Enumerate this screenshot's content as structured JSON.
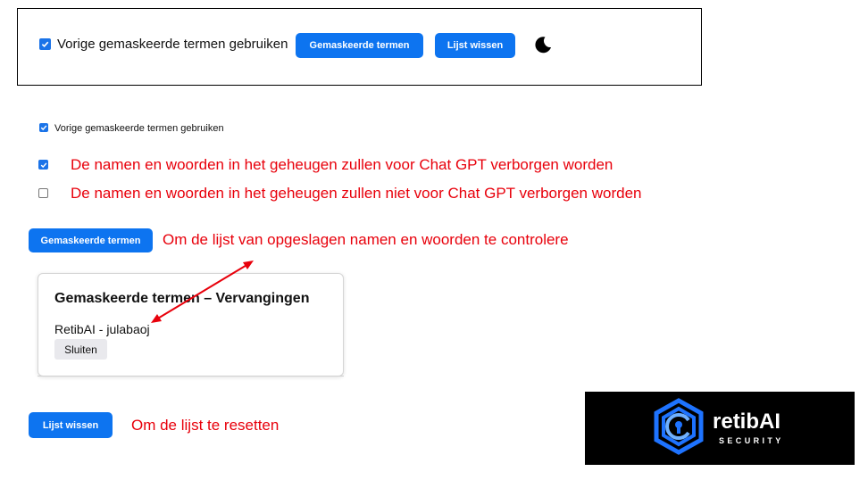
{
  "toolbar": {
    "checkbox_label": "Vorige gemaskeerde termen gebruiken",
    "checkbox_checked": true,
    "masked_terms_button": "Gemaskeerde termen",
    "clear_list_button": "Lijst wissen"
  },
  "small_checkbox": {
    "label": "Vorige gemaskeerde termen gebruiken",
    "checked": true
  },
  "legend": {
    "checked_text": "De namen en woorden in het geheugen zullen voor Chat GPT verborgen worden",
    "unchecked_text": "De namen en woorden in het geheugen zullen niet voor Chat GPT verborgen worden"
  },
  "masked_terms": {
    "button_label": "Gemaskeerde termen",
    "annotation": "Om de lijst van opgeslagen namen en woorden te controlere"
  },
  "popup": {
    "title": "Gemaskeerde termen – Vervangingen",
    "entry_original": "RetibAI",
    "entry_separator": " - ",
    "entry_replacement": "julabaoj",
    "close_button": "Sluiten"
  },
  "clear_list": {
    "button_label": "Lijst wissen",
    "annotation": "Om de lijst te resetten"
  },
  "logo": {
    "name": "retibAI",
    "tagline": "SECURITY"
  },
  "colors": {
    "accent_blue": "#0d74f0",
    "annotation_red": "#e8000b",
    "logo_blue": "#1e73ff"
  }
}
